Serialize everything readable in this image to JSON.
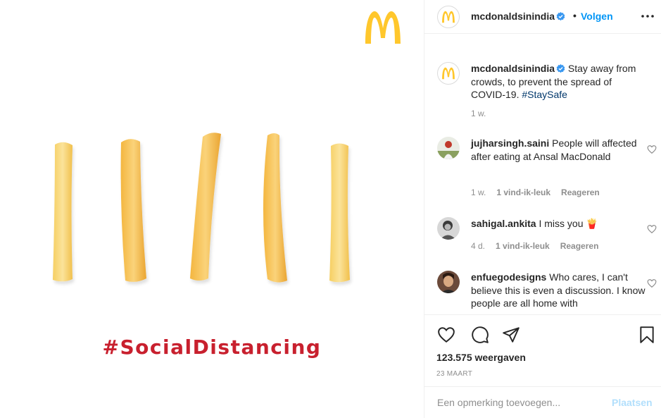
{
  "account": {
    "username": "mcdonaldsinindia",
    "follow_separator": "•",
    "follow_label": "Volgen"
  },
  "media": {
    "hashtag": "#SocialDistancing",
    "brand_color": "#c8202e",
    "logo_color": "#ffc72c"
  },
  "caption": {
    "username": "mcdonaldsinindia",
    "text": "Stay away from crowds, to prevent the spread of COVID-19.",
    "hashtag": "#StaySafe",
    "time": "1 w."
  },
  "comments": [
    {
      "username": "jujharsingh.saini",
      "text": "People will affected after eating at Ansal MacDonald",
      "time": "1 w.",
      "likes": "1 vind-ik-leuk",
      "reply": "Reageren"
    },
    {
      "username": "sahigal.ankita",
      "text": "I miss you",
      "emoji": "🍟",
      "time": "4 d.",
      "likes": "1 vind-ik-leuk",
      "reply": "Reageren"
    },
    {
      "username": "enfuegodesigns",
      "text": "Who cares, I can't believe this is even a discussion. I know people are all home with"
    }
  ],
  "actions": {
    "like_icon": "heart-icon",
    "comment_icon": "comment-icon",
    "share_icon": "paper-plane-icon",
    "save_icon": "bookmark-icon"
  },
  "stats": {
    "views": "123.575 weergaven",
    "date": "23 MAART"
  },
  "add_comment": {
    "placeholder": "Een opmerking toevoegen...",
    "post_label": "Plaatsen"
  },
  "colors": {
    "link": "#0095f6",
    "hashtag_link": "#00376b",
    "muted": "#8e8e8e",
    "verified": "#3897f0"
  }
}
